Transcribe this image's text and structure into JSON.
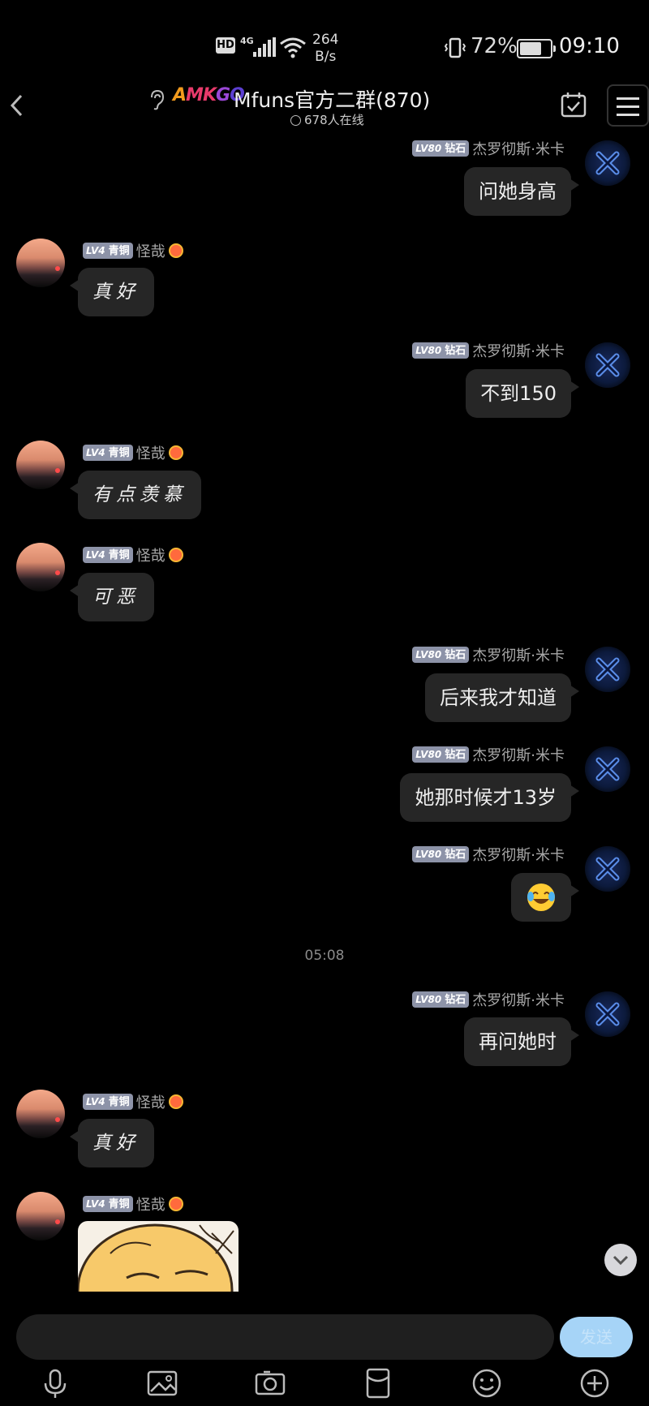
{
  "status_bar": {
    "hd": "HD",
    "signal": "4G",
    "net_speed_value": "264",
    "net_speed_unit": "B/s",
    "battery": "72%",
    "time": "09:10"
  },
  "header": {
    "logo_letters": [
      "A",
      "M",
      "K",
      "G",
      "O"
    ],
    "title": "Mfuns官方二群(870)",
    "online": "678人在线"
  },
  "messages": [
    {
      "side": "right",
      "level": "LV80",
      "rank": "钻石",
      "name": "杰罗彻斯·米卡",
      "text": "问她身高"
    },
    {
      "side": "left",
      "level": "LV4",
      "rank": "青铜",
      "name": "怪哉",
      "text": "真好"
    },
    {
      "side": "right",
      "level": "LV80",
      "rank": "钻石",
      "name": "杰罗彻斯·米卡",
      "text": "不到150"
    },
    {
      "side": "left",
      "level": "LV4",
      "rank": "青铜",
      "name": "怪哉",
      "text": "有点羡慕"
    },
    {
      "side": "left",
      "level": "LV4",
      "rank": "青铜",
      "name": "怪哉",
      "text": "可恶"
    },
    {
      "side": "right",
      "level": "LV80",
      "rank": "钻石",
      "name": "杰罗彻斯·米卡",
      "text": "后来我才知道"
    },
    {
      "side": "right",
      "level": "LV80",
      "rank": "钻石",
      "name": "杰罗彻斯·米卡",
      "text": "她那时候才13岁"
    },
    {
      "side": "right",
      "level": "LV80",
      "rank": "钻石",
      "name": "杰罗彻斯·米卡",
      "text": "",
      "emoji": "face-with-tears-of-joy"
    },
    {
      "side": "right",
      "level": "LV80",
      "rank": "钻石",
      "name": "杰罗彻斯·米卡",
      "text": "再问她时"
    },
    {
      "side": "left",
      "level": "LV4",
      "rank": "青铜",
      "name": "怪哉",
      "text": "真好"
    },
    {
      "side": "left",
      "level": "LV4",
      "rank": "青铜",
      "name": "怪哉",
      "text": "",
      "image": "anime-sticker"
    }
  ],
  "timestamp": "05:08",
  "input": {
    "placeholder": "",
    "send_label": "发送"
  },
  "toolbar": [
    "microphone-icon",
    "image-icon",
    "camera-icon",
    "red-packet-icon",
    "emoji-icon",
    "plus-icon"
  ],
  "colors": {
    "bubble": "#262626",
    "send": "#a6d4f7",
    "level_badge": "#8d93a8"
  }
}
